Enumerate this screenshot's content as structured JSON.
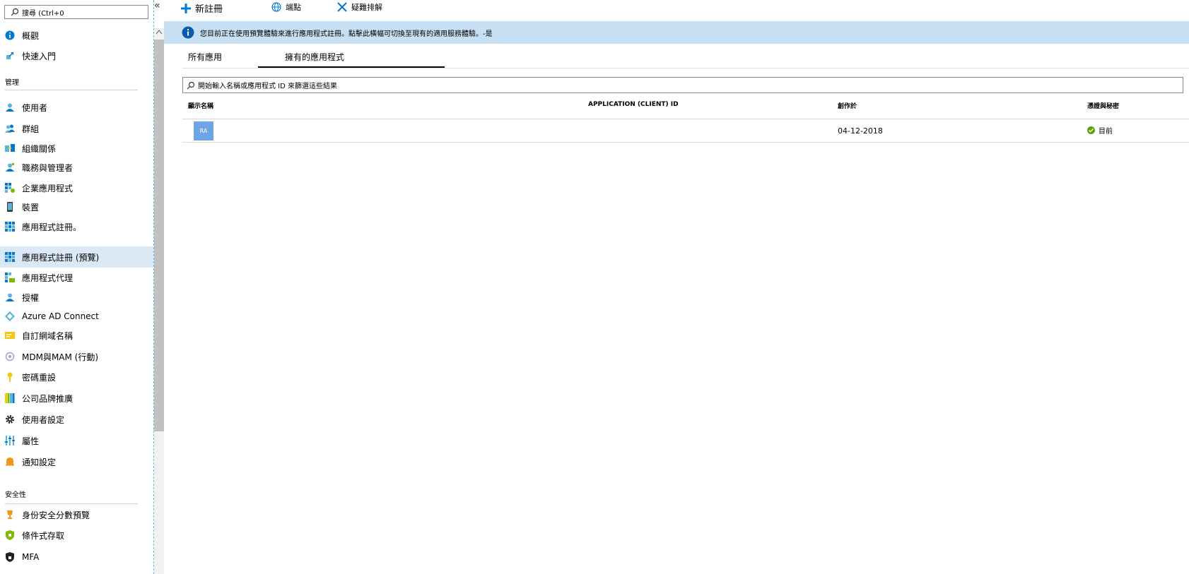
{
  "sidebar": {
    "search": {
      "placeholder": "搜尋 (Ctrl+0"
    },
    "collapse_glyph": "«",
    "items_top": [
      {
        "label": "概觀",
        "icon": "info-icon"
      },
      {
        "label": "快速入門",
        "icon": "rocket-icon"
      }
    ],
    "section_manage": "管理",
    "items_manage": [
      {
        "label": "使用者",
        "icon": "user-icon"
      },
      {
        "label": "群組",
        "icon": "group-icon"
      },
      {
        "label": "組織關係",
        "icon": "org-relationship-icon"
      },
      {
        "label": "職務與管理者",
        "icon": "roles-icon"
      },
      {
        "label": "企業應用程式",
        "icon": "enterprise-apps-icon"
      },
      {
        "label": "裝置",
        "icon": "device-icon"
      },
      {
        "label": "應用程式註冊。",
        "icon": "app-registrations-icon"
      },
      {
        "label": "應用程式註冊 (預覽)",
        "icon": "app-registrations-preview-icon"
      },
      {
        "label": "應用程式代理",
        "icon": "app-proxy-icon"
      },
      {
        "label": "授權",
        "icon": "licenses-icon"
      },
      {
        "label": "Azure AD Connect",
        "icon": "azure-ad-connect-icon"
      },
      {
        "label": "自訂網域名稱",
        "icon": "custom-domain-icon"
      },
      {
        "label": "MDM與MAM (行動)",
        "icon": "mobility-icon"
      },
      {
        "label": "密碼重設",
        "icon": "key-icon"
      },
      {
        "label": "公司品牌推廣",
        "icon": "branding-icon"
      },
      {
        "label": "使用者設定",
        "icon": "gear-icon"
      },
      {
        "label": "屬性",
        "icon": "properties-icon"
      },
      {
        "label": "通知設定",
        "icon": "bell-icon"
      }
    ],
    "section_security": "安全性",
    "items_security": [
      {
        "label": "身份安全分數預覽",
        "icon": "trophy-icon"
      },
      {
        "label": "條件式存取",
        "icon": "conditional-access-icon"
      },
      {
        "label": "MFA",
        "icon": "lock-icon"
      }
    ],
    "active_item": "應用程式註冊 (預覽)"
  },
  "toolbar": {
    "new_registration": "新註冊",
    "endpoints": "端點",
    "troubleshoot": "疑難排解"
  },
  "banner": {
    "text": "您目前正在使用預覽體驗來進行應用程式註冊。點擊此橫幅可切換至現有的適用服務體驗。-是"
  },
  "tabs": {
    "all_apps": "所有應用",
    "owned_apps": "擁有的應用程式",
    "selected": "擁有的應用程式"
  },
  "filter": {
    "placeholder": "開始輸入名稱或應用程式 ID 來篩選這些結果"
  },
  "table": {
    "headers": {
      "display_name": "顯示名稱",
      "app_id": "APPLICATION (CLIENT) ID",
      "created": "創作於",
      "certs": "憑證與秘密"
    },
    "rows": [
      {
        "avatar": "RA",
        "display_name": "",
        "app_id": "",
        "created": "04-12-2018",
        "status": "目前"
      }
    ]
  },
  "colors": {
    "accent": "#0078d4",
    "banner_bg": "#c7e0f4",
    "active_bg": "#dbe9f7",
    "status_ok": "#57a300",
    "avatar_bg": "#6da5e6"
  }
}
